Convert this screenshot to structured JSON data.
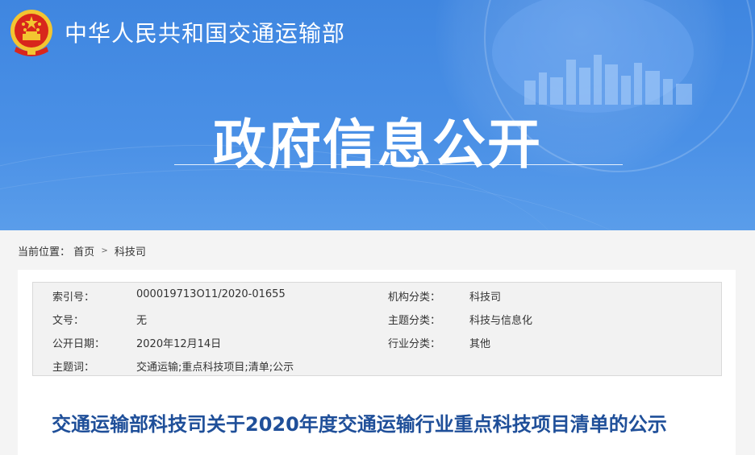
{
  "header": {
    "ministry_name": "中华人民共和国交通运输部",
    "banner_title": "政府信息公开"
  },
  "breadcrumb": {
    "label": "当前位置：",
    "home": "首页",
    "separator": ">",
    "current": "科技司"
  },
  "meta": {
    "index_label": "索引号：",
    "index_value": "000019713O11/2020-01655",
    "org_label": "机构分类：",
    "org_value": "科技司",
    "doc_no_label": "文号：",
    "doc_no_value": "无",
    "topic_label": "主题分类：",
    "topic_value": "科技与信息化",
    "date_label": "公开日期：",
    "date_value": "2020年12月14日",
    "industry_label": "行业分类：",
    "industry_value": "其他",
    "keywords_label": "主题词：",
    "keywords_value": "交通运输;重点科技项目;清单;公示"
  },
  "document": {
    "title": "交通运输部科技司关于2020年度交通运输行业重点科技项目清单的公示"
  },
  "colors": {
    "banner_blue": "#4a90e6",
    "title_blue": "#1f4f99",
    "emblem_red": "#d8261c",
    "emblem_gold": "#f3c530"
  }
}
